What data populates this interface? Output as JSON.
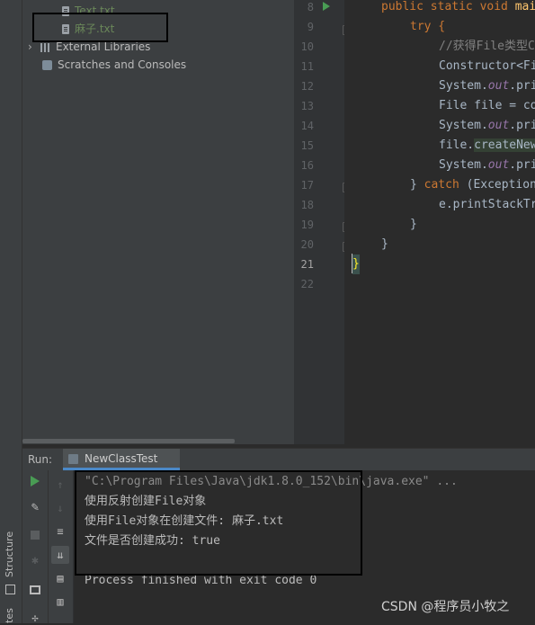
{
  "sidebar": {
    "structure_tab": "Structure",
    "favorites_tab": "tes"
  },
  "project_tree": {
    "items": [
      {
        "label": "Text.txt",
        "color": "#6a8759"
      },
      {
        "label": "麻子.txt",
        "color": "#6a8759"
      },
      {
        "label": "External Libraries",
        "color": "#bbbbbb"
      },
      {
        "label": "Scratches and Consoles",
        "color": "#bbbbbb"
      }
    ]
  },
  "editor": {
    "line_numbers": [
      "8",
      "9",
      "10",
      "11",
      "12",
      "13",
      "14",
      "15",
      "16",
      "17",
      "18",
      "19",
      "20",
      "21",
      "22"
    ],
    "current_line": "21",
    "lines": {
      "l8a": "public static void ",
      "l8b": "mai",
      "l9": "try {",
      "l10": "//获得File类型C",
      "l11": "Constructor<Fi",
      "l12a": "System.",
      "l12b": "out",
      "l12c": ".pri",
      "l13": "File file = co",
      "l14a": "System.",
      "l14b": "out",
      "l14c": ".pri",
      "l15a": "file.",
      "l15b": "createNew",
      "l16a": "System.",
      "l16b": "out",
      "l16c": ".pri",
      "l17a": "} ",
      "l17b": "catch",
      "l17c": " (Exception",
      "l18": "e.printStackTr",
      "l19": "}",
      "l20": "}",
      "l21": "}"
    }
  },
  "run": {
    "label": "Run:",
    "tab_name": "NewClassTest"
  },
  "console": {
    "lines": [
      "\"C:\\Program Files\\Java\\jdk1.8.0_152\\bin\\java.exe\" ...",
      "使用反射创建File对象",
      "使用File对象在创建文件: 麻子.txt",
      "文件是否创建成功: true",
      "",
      "Process finished with exit code 0"
    ]
  },
  "watermark": "CSDN @程序员小牧之"
}
